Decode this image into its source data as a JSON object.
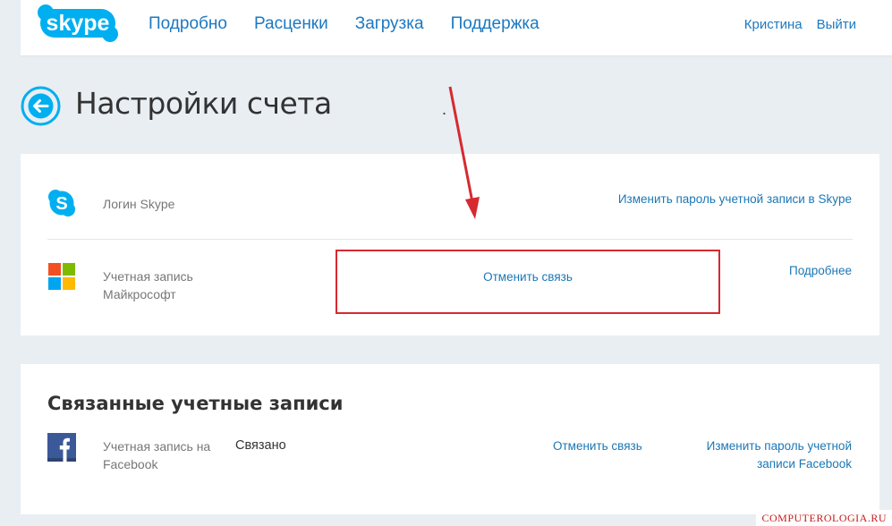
{
  "header": {
    "logo_text": "skype",
    "nav": [
      "Подробно",
      "Расценки",
      "Загрузка",
      "Поддержка"
    ],
    "user_name": "Кристина",
    "logout": "Выйти"
  },
  "page": {
    "title": "Настройки счета",
    "dot": "."
  },
  "account": {
    "skype_login_label": "Логин Skype",
    "change_password_link": "Изменить пароль учетной записи в Skype",
    "microsoft_label_line1": "Учетная запись",
    "microsoft_label_line2": "Майкрософт",
    "unlink": "Отменить связь",
    "more": "Подробнее"
  },
  "linked": {
    "title": "Связанные учетные записи",
    "facebook_label_line1": "Учетная запись на",
    "facebook_label_line2": "Facebook",
    "status": "Связано",
    "unlink": "Отменить связь",
    "change_password_line1": "Изменить пароль учетной",
    "change_password_line2": "записи Facebook"
  },
  "watermark": "COMPUTEROLOGIA.RU",
  "colors": {
    "skype_blue": "#00aff0",
    "link_blue": "#1b77b5",
    "highlight_red": "#d62930",
    "facebook_blue": "#3b5998"
  }
}
